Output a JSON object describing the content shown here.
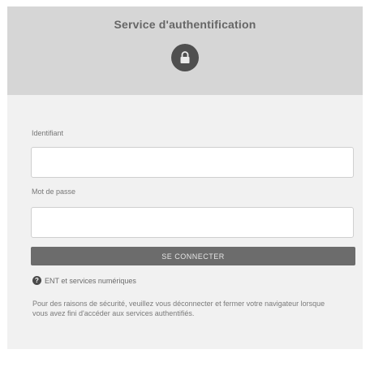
{
  "header": {
    "title": "Service d'authentification",
    "icon": "lock-icon"
  },
  "form": {
    "username": {
      "label": "Identifiant",
      "value": "",
      "placeholder": ""
    },
    "password": {
      "label": "Mot de passe",
      "value": "",
      "placeholder": ""
    },
    "submit_label": "SE CONNECTER"
  },
  "help": {
    "icon": "question-circle-icon",
    "link_label": "ENT et services numériques"
  },
  "notice": "Pour des raisons de sécurité, veuillez vous déconnecter et fermer votre navigateur lorsque vous avez fini d'accéder aux services authentifiés.",
  "colors": {
    "header_bg": "#d6d6d6",
    "panel_bg": "#f1f1f1",
    "button_bg": "#6c6c6c",
    "icon_circle": "#4f4f4f"
  }
}
